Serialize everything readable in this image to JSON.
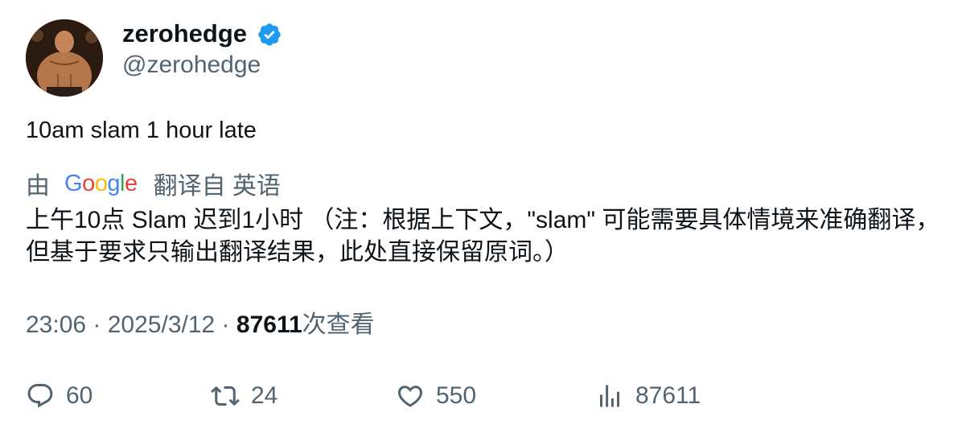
{
  "author": {
    "display_name": "zerohedge",
    "handle": "@zerohedge",
    "verified": true,
    "verified_color": "#1d9bf0"
  },
  "tweet": {
    "text": "10am slam 1 hour late"
  },
  "translation": {
    "by_label": "由",
    "provider": "Google",
    "from_label": "翻译自 英语",
    "text": "上午10点 Slam 迟到1小时 （注：根据上下文，\"slam\" 可能需要具体情境来准确翻译，但基于要求只输出翻译结果，此处直接保留原词。）"
  },
  "meta": {
    "time": "23:06",
    "separator1": " · ",
    "date": "2025/3/12",
    "separator2": " · ",
    "views_count": "87611",
    "views_label": "次查看"
  },
  "actions": {
    "reply_count": "60",
    "retweet_count": "24",
    "like_count": "550",
    "views_count": "87611"
  },
  "icons": {
    "reply": "reply-icon",
    "retweet": "retweet-icon",
    "like": "heart-icon",
    "views": "bar-chart-icon",
    "verified": "verified-badge-icon"
  },
  "colors": {
    "text_primary": "#0f1419",
    "text_secondary": "#536471",
    "google_blue": "#4285f4",
    "google_red": "#ea4335",
    "google_yellow": "#fbbc05",
    "google_green": "#34a853"
  }
}
